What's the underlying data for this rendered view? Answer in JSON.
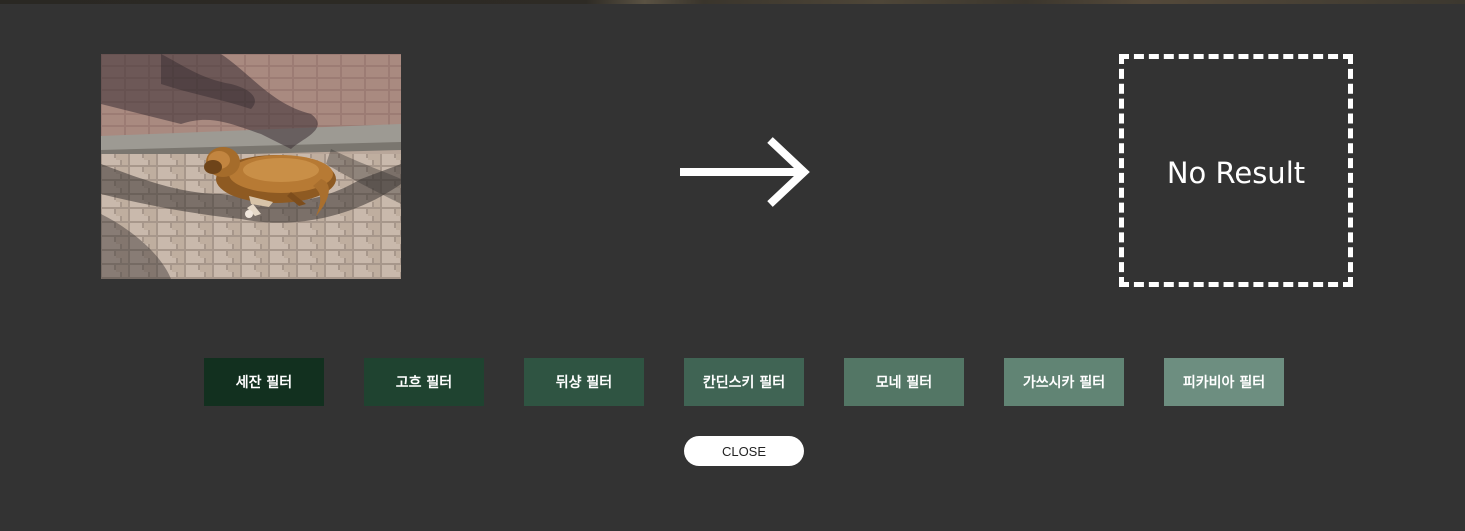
{
  "source_image": {
    "alt": "dog sleeping on brick pavement",
    "icon": "photo-image"
  },
  "arrow": {
    "icon": "arrow-right-icon",
    "color": "#ffffff"
  },
  "result": {
    "text": "No Result",
    "border_color": "#ffffff"
  },
  "filters": [
    {
      "label": "세잔 필터",
      "color": "#12301f"
    },
    {
      "label": "고흐 필터",
      "color": "#1f4330"
    },
    {
      "label": "뒤샹 필터",
      "color": "#2f5442"
    },
    {
      "label": "칸딘스키 필터",
      "color": "#406454"
    },
    {
      "label": "모네 필터",
      "color": "#537665"
    },
    {
      "label": "가쓰시카 필터",
      "color": "#618474"
    },
    {
      "label": "피카비아 필터",
      "color": "#6d8e80"
    }
  ],
  "close_button": {
    "label": "CLOSE"
  },
  "colors": {
    "background": "#333333",
    "text": "#ffffff"
  }
}
